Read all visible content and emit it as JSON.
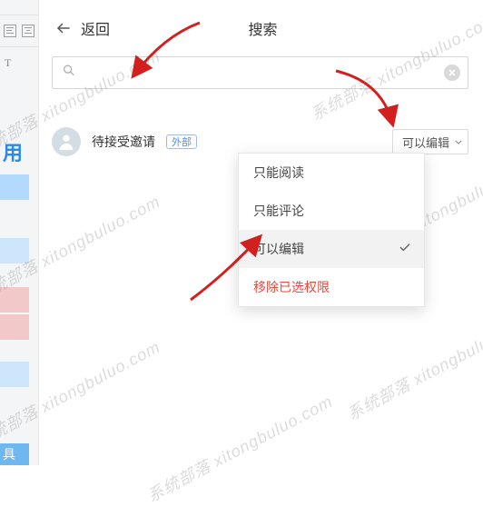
{
  "bg": {
    "sel_region": "选区",
    "title_char": "用",
    "footer_char": "具"
  },
  "header": {
    "back_label": "返回",
    "title": "搜索"
  },
  "search": {
    "placeholder": "",
    "value": ""
  },
  "user": {
    "name": "待接受邀请",
    "tag": "外部"
  },
  "perm": {
    "current": "可以编辑"
  },
  "dropdown": {
    "items": [
      {
        "label": "只能阅读",
        "selected": false,
        "danger": false
      },
      {
        "label": "只能评论",
        "selected": false,
        "danger": false
      },
      {
        "label": "可以编辑",
        "selected": true,
        "danger": false
      },
      {
        "label": "移除已选权限",
        "selected": false,
        "danger": true
      }
    ]
  },
  "watermark": "系统部落 xitongbuluo.com"
}
